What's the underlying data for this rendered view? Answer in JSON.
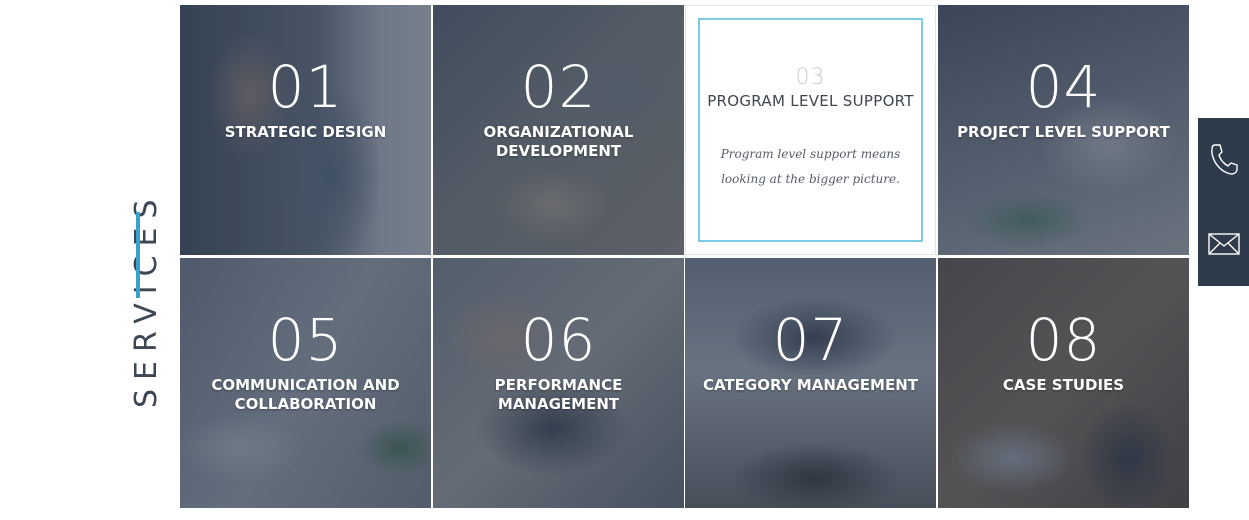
{
  "section": {
    "title": "SERVICES"
  },
  "services": [
    {
      "number": "01",
      "title": "STRATEGIC DESIGN"
    },
    {
      "number": "02",
      "title": "ORGANIZATIONAL DEVELOPMENT"
    },
    {
      "number": "03",
      "title": "PROGRAM LEVEL SUPPORT",
      "description": "Program level support means looking at the bigger picture."
    },
    {
      "number": "04",
      "title": "PROJECT LEVEL SUPPORT"
    },
    {
      "number": "05",
      "title": "COMMUNICATION AND COLLABORATION"
    },
    {
      "number": "06",
      "title": "PERFORMANCE MANAGEMENT"
    },
    {
      "number": "07",
      "title": "CATEGORY MANAGEMENT"
    },
    {
      "number": "08",
      "title": "CASE STUDIES"
    }
  ],
  "contact": {
    "icons": [
      "phone-icon",
      "mail-icon"
    ]
  },
  "colors": {
    "accent": "#3aa0cf",
    "frame": "#7dcbe6",
    "panel": "#2e3b4b",
    "overlay": "#303e52",
    "text_dark": "#3d4653"
  }
}
